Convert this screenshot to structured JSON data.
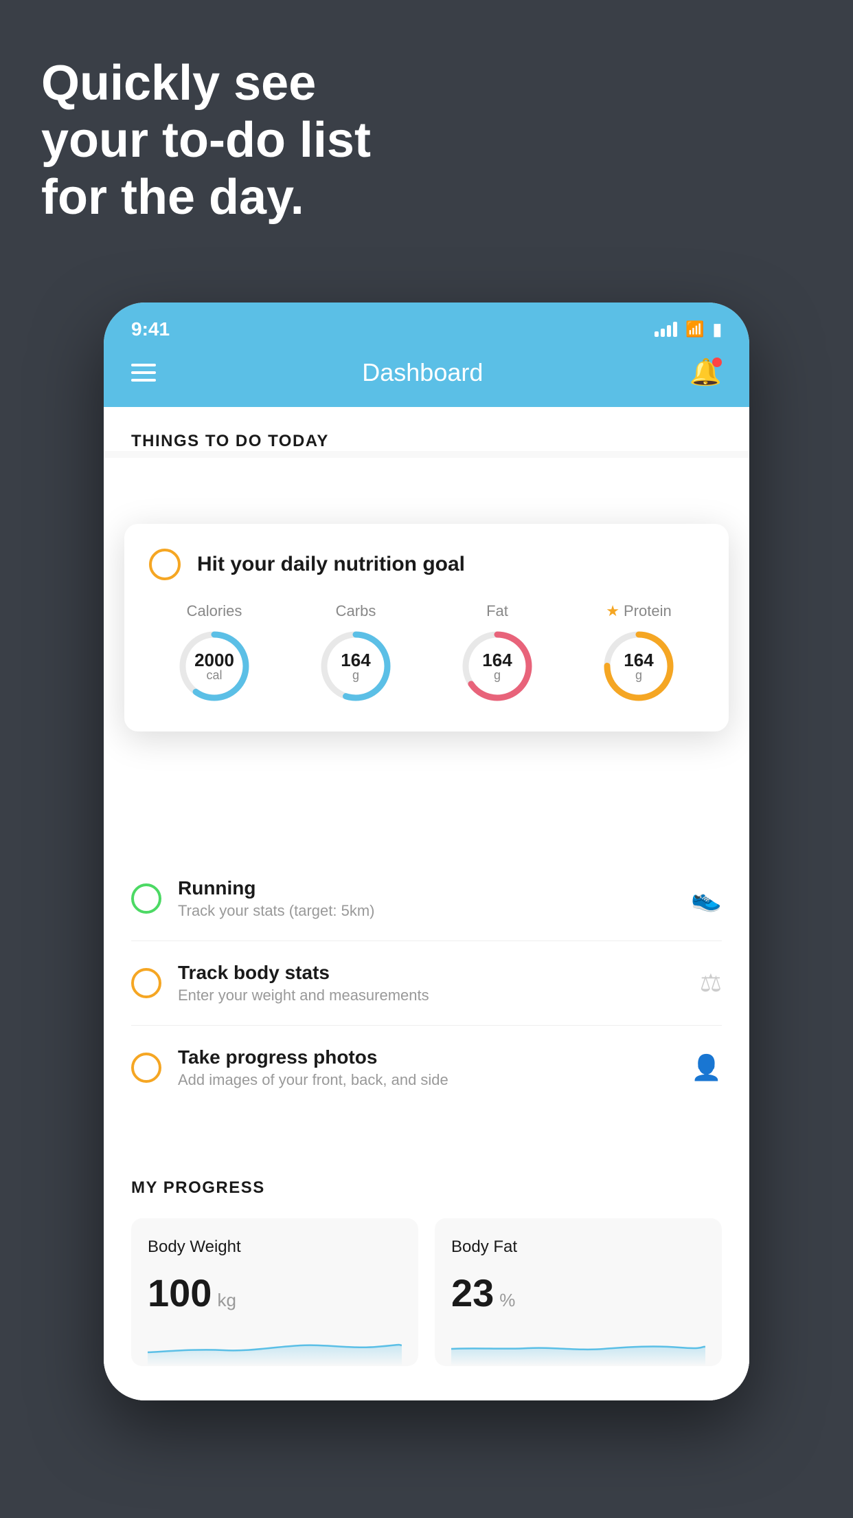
{
  "hero": {
    "line1": "Quickly see",
    "line2": "your to-do list",
    "line3": "for the day."
  },
  "statusBar": {
    "time": "9:41",
    "signal": "signal",
    "wifi": "wifi",
    "battery": "battery"
  },
  "header": {
    "title": "Dashboard"
  },
  "thingsSection": {
    "title": "THINGS TO DO TODAY"
  },
  "floatingCard": {
    "circleColor": "#f5a623",
    "title": "Hit your daily nutrition goal",
    "nutrition": [
      {
        "label": "Calories",
        "value": "2000",
        "unit": "cal",
        "color": "#5bbfe6",
        "percent": 60
      },
      {
        "label": "Carbs",
        "value": "164",
        "unit": "g",
        "color": "#5bbfe6",
        "percent": 55
      },
      {
        "label": "Fat",
        "value": "164",
        "unit": "g",
        "color": "#e8637a",
        "percent": 70
      },
      {
        "label": "Protein",
        "value": "164",
        "unit": "g",
        "color": "#f5a623",
        "percent": 75,
        "starred": true
      }
    ]
  },
  "todoItems": [
    {
      "title": "Running",
      "subtitle": "Track your stats (target: 5km)",
      "circleColor": "green",
      "icon": "👟"
    },
    {
      "title": "Track body stats",
      "subtitle": "Enter your weight and measurements",
      "circleColor": "yellow",
      "icon": "⚖"
    },
    {
      "title": "Take progress photos",
      "subtitle": "Add images of your front, back, and side",
      "circleColor": "yellow",
      "icon": "👤"
    }
  ],
  "progressSection": {
    "title": "MY PROGRESS",
    "cards": [
      {
        "title": "Body Weight",
        "value": "100",
        "unit": "kg"
      },
      {
        "title": "Body Fat",
        "value": "23",
        "unit": "%"
      }
    ]
  }
}
